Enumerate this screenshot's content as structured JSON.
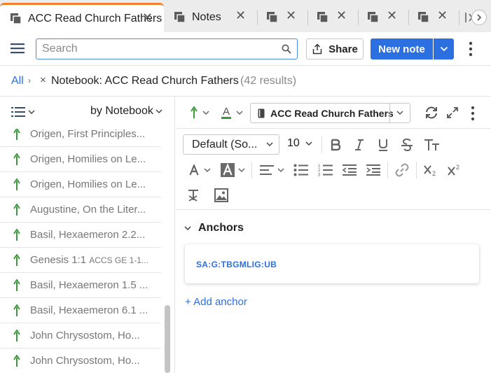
{
  "tabs": [
    {
      "title": "ACC Read Church Fathers",
      "active": true
    },
    {
      "title": "Notes",
      "active": false
    },
    {
      "title": "",
      "active": false
    },
    {
      "title": "",
      "active": false
    },
    {
      "title": "",
      "active": false
    },
    {
      "title": "",
      "active": false
    }
  ],
  "toolbar": {
    "search_placeholder": "Search",
    "share_label": "Share",
    "new_note_label": "New note"
  },
  "breadcrumb": {
    "all": "All",
    "notebook": "Notebook: ACC Read Church Fathers",
    "results": "(42 results)"
  },
  "list": {
    "sort_label": "by Notebook",
    "items": [
      {
        "text": "Origen, First Principles...",
        "sub": ""
      },
      {
        "text": "Origen, Homilies on Le...",
        "sub": ""
      },
      {
        "text": "Origen, Homilies on Le...",
        "sub": ""
      },
      {
        "text": "Augustine, On the Liter...",
        "sub": ""
      },
      {
        "text": "Basil, Hexaemeron 2.2...",
        "sub": ""
      },
      {
        "text": "Genesis 1:1 ",
        "sub": "ACCS GE 1-1..."
      },
      {
        "text": "Basil, Hexaemeron 1.5 ...",
        "sub": ""
      },
      {
        "text": "Basil, Hexaemeron 6.1 ...",
        "sub": ""
      },
      {
        "text": "John Chrysostom, Ho...",
        "sub": ""
      },
      {
        "text": "John Chrysostom, Ho...",
        "sub": ""
      }
    ]
  },
  "editor": {
    "notebook_label": "ACC Read Church Fathers",
    "font_family": "Default (So...",
    "font_size": "10",
    "anchors_title": "Anchors",
    "anchor_ref": "SA:G:TBGMLIG:UB",
    "add_anchor": "+ Add anchor",
    "highlight_letter": "A",
    "text_color_letter": "A"
  },
  "colors": {
    "accent": "#2b6fe0",
    "active_tab": "#f0822d",
    "pin_green": "#3a9a3a"
  }
}
